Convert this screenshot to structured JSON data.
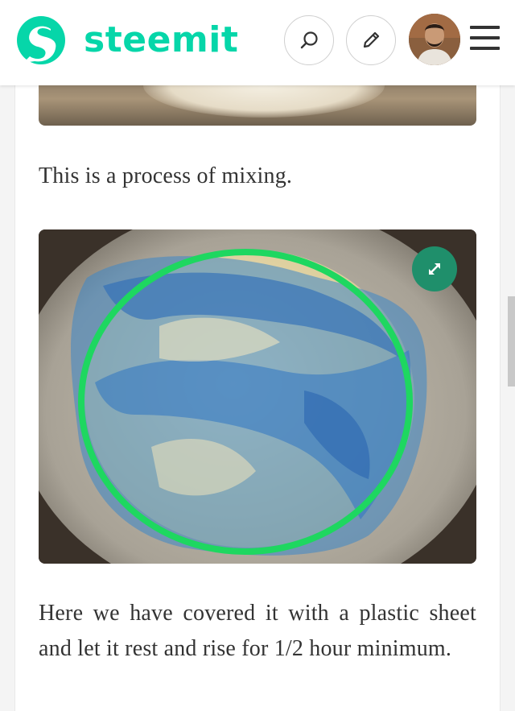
{
  "header": {
    "logo_text": "steemit",
    "search_label": "Search",
    "write_label": "Write",
    "avatar_label": "Profile",
    "menu_label": "Menu"
  },
  "post": {
    "paragraph_1": "This is a process of mixing.",
    "paragraph_2": "Here we have covered it with a plastic sheet and let it rest and rise for 1/2 hour minimum."
  },
  "colors": {
    "brand": "#06d6a9",
    "expand_button": "#1f8f6b",
    "highlight_circle": "#1ed760"
  },
  "icons": {
    "search": "search-icon",
    "write": "pencil-icon",
    "expand": "expand-icon",
    "menu": "hamburger-icon"
  }
}
